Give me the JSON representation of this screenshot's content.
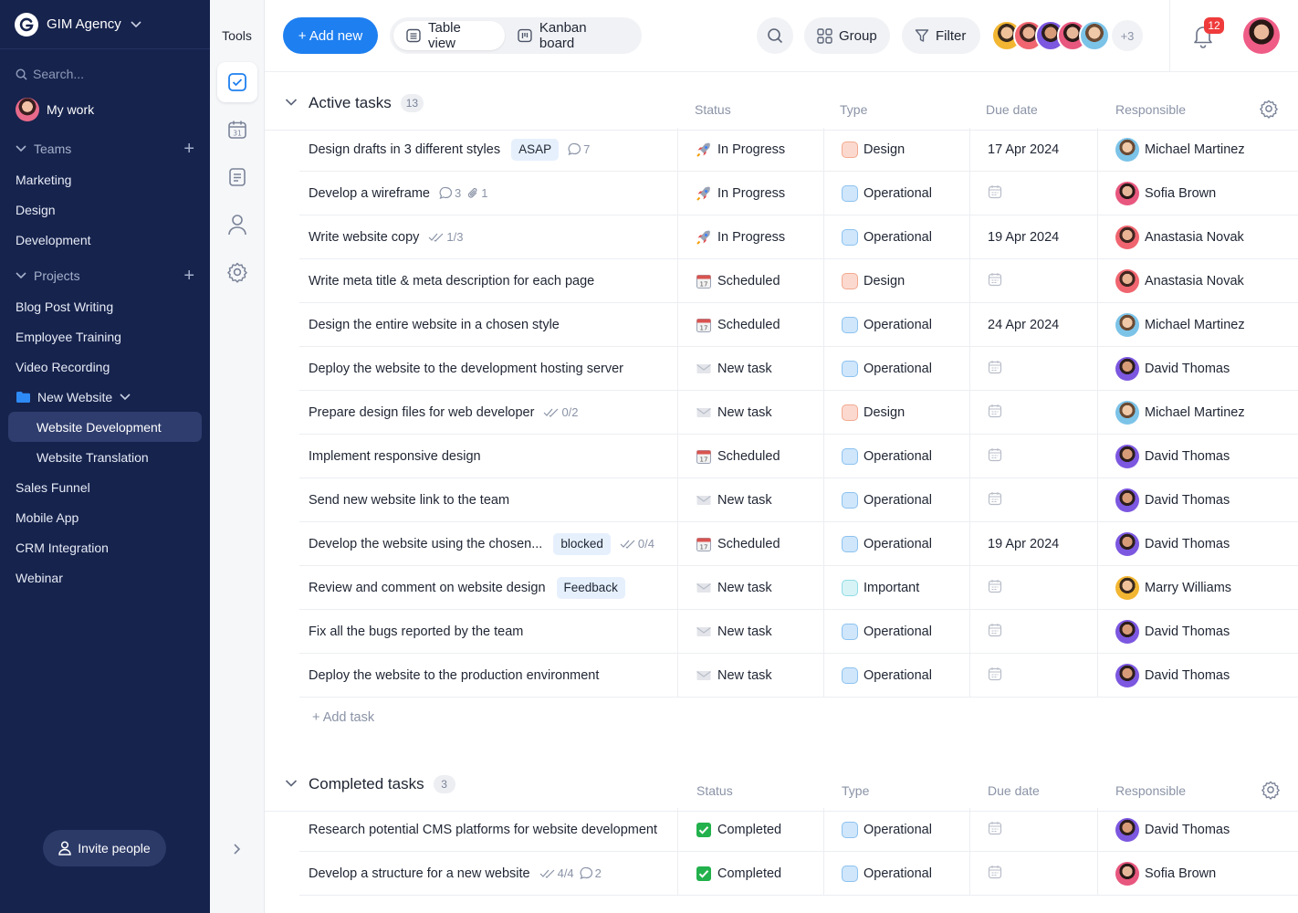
{
  "workspace": {
    "name": "GIM Agency"
  },
  "sidebar": {
    "search_placeholder": "Search...",
    "my_work": "My work",
    "teams": {
      "label": "Teams",
      "items": [
        "Marketing",
        "Design",
        "Development"
      ]
    },
    "projects": {
      "label": "Projects",
      "items": [
        "Blog Post Writing",
        "Employee Training",
        "Video Recording"
      ],
      "folder": {
        "label": "New Website",
        "children": [
          "Website Development",
          "Website Translation"
        ]
      },
      "after": [
        "Sales Funnel",
        "Mobile App",
        "CRM Integration",
        "Webinar"
      ]
    },
    "invite": "Invite people"
  },
  "tools": {
    "label": "Tools"
  },
  "topbar": {
    "add_new": "+ Add new",
    "views": [
      "Table view",
      "Kanban board"
    ],
    "group": "Group",
    "filter": "Filter",
    "more_members": "+3",
    "notifications": "12"
  },
  "columns": {
    "status": "Status",
    "type": "Type",
    "due": "Due date",
    "responsible": "Responsible"
  },
  "colors": {
    "accent": "#1e7ff0",
    "design": "#fcd9cf",
    "operational": "#cfe6fb",
    "important": "#d7f3f6",
    "sidebar": "#16234d"
  },
  "active": {
    "title": "Active tasks",
    "count": "13",
    "add_task": "+ Add task",
    "rows": [
      {
        "task": "Design drafts in 3 different styles",
        "tag": "ASAP",
        "comments": "7",
        "status": "In Progress",
        "status_icon": "rocket",
        "type": "Design",
        "due": "17 Apr 2024",
        "resp": "Michael Martinez"
      },
      {
        "task": "Develop a wireframe",
        "comments": "3",
        "attachments": "1",
        "status": "In Progress",
        "status_icon": "rocket",
        "type": "Operational",
        "due": "",
        "resp": "Sofia Brown"
      },
      {
        "task": "Write website copy",
        "checklist": "1/3",
        "status": "In Progress",
        "status_icon": "rocket",
        "type": "Operational",
        "due": "19 Apr 2024",
        "resp": "Anastasia Novak"
      },
      {
        "task": "Write meta title & meta description for each page",
        "status": "Scheduled",
        "status_icon": "calendar",
        "type": "Design",
        "due": "",
        "resp": "Anastasia Novak"
      },
      {
        "task": "Design the entire website in a chosen style",
        "status": "Scheduled",
        "status_icon": "calendar",
        "type": "Operational",
        "due": "24 Apr 2024",
        "resp": "Michael Martinez"
      },
      {
        "task": "Deploy the website to the development hosting server",
        "status": "New task",
        "status_icon": "envelope",
        "type": "Operational",
        "due": "",
        "resp": "David Thomas"
      },
      {
        "task": "Prepare design files for web developer",
        "checklist": "0/2",
        "status": "New task",
        "status_icon": "envelope",
        "type": "Design",
        "due": "",
        "resp": "Michael Martinez"
      },
      {
        "task": "Implement responsive design",
        "status": "Scheduled",
        "status_icon": "calendar",
        "type": "Operational",
        "due": "",
        "resp": "David Thomas"
      },
      {
        "task": "Send new website link to the team",
        "status": "New task",
        "status_icon": "envelope",
        "type": "Operational",
        "due": "",
        "resp": "David Thomas"
      },
      {
        "task": "Develop the website using the chosen...",
        "tag": "blocked",
        "checklist": "0/4",
        "status": "Scheduled",
        "status_icon": "calendar",
        "type": "Operational",
        "due": "19 Apr 2024",
        "resp": "David Thomas"
      },
      {
        "task": "Review and comment on website design",
        "tag": "Feedback",
        "status": "New task",
        "status_icon": "envelope",
        "type": "Important",
        "due": "",
        "resp": "Marry Williams"
      },
      {
        "task": "Fix all the bugs reported by the team",
        "status": "New task",
        "status_icon": "envelope",
        "type": "Operational",
        "due": "",
        "resp": "David Thomas"
      },
      {
        "task": "Deploy the website to the production environment",
        "status": "New task",
        "status_icon": "envelope",
        "type": "Operational",
        "due": "",
        "resp": "David Thomas"
      }
    ]
  },
  "completed": {
    "title": "Completed tasks",
    "count": "3",
    "rows": [
      {
        "task": "Research potential CMS platforms for website development",
        "status": "Completed",
        "status_icon": "check",
        "type": "Operational",
        "due": "",
        "resp": "David Thomas"
      },
      {
        "task": "Develop a structure for a new website",
        "checklist": "4/4",
        "comments": "2",
        "status": "Completed",
        "status_icon": "check",
        "type": "Operational",
        "due": "",
        "resp": "Sofia Brown"
      }
    ]
  }
}
